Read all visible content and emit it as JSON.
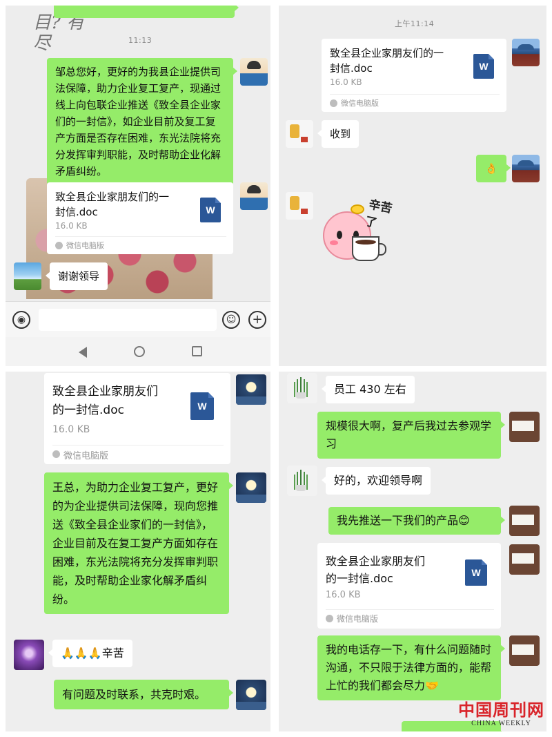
{
  "file_card": {
    "name_full": "致全县企业家朋友们的一封信.doc",
    "name_line1": "致全县企业家朋友们的一",
    "name_line1_p3": "致全县企业家朋友们",
    "name_line2": "封信.doc",
    "name_line2_p3": "的一封信.doc",
    "size": "16.0 KB",
    "source": "微信电脑版",
    "icon_letter": "W"
  },
  "panel1": {
    "time": "11:13",
    "calligraphy": "目? 有尽",
    "messages": [
      {
        "type": "text",
        "side": "right",
        "text": "邹总您好，更好的为我县企业提供司法保障，助力企业复工复产，现通过线上向包联企业推送《致全县企业家们的一封信》，如企业目前及复工复产方面是否存在困难，东光法院将充分发挥审判职能，及时帮助企业化解矛盾纠纷。"
      },
      {
        "type": "file",
        "side": "right"
      },
      {
        "type": "text",
        "side": "left",
        "text": "谢谢领导"
      }
    ],
    "input_bar": {
      "voice_icon": "voice-icon",
      "emoji_icon": "emoji-icon",
      "plus_icon": "plus-icon"
    },
    "nav": {
      "back": "back-icon",
      "home": "home-icon",
      "recent": "recent-apps-icon"
    }
  },
  "panel2": {
    "time": "上午11:14",
    "messages": [
      {
        "type": "file",
        "side": "right"
      },
      {
        "type": "text",
        "side": "left",
        "text": "收到"
      },
      {
        "type": "emoji",
        "side": "right",
        "text": "👌"
      },
      {
        "type": "sticker",
        "side": "left",
        "text": "辛苦了"
      }
    ]
  },
  "panel3": {
    "messages": [
      {
        "type": "file",
        "side": "right"
      },
      {
        "type": "text",
        "side": "right",
        "text": "王总，为助力企业复工复产，更好的为企业提供司法保障，现向您推送《致全县企业家们的一封信》，企业目前及在复工复产方面如存在困难，东光法院将充分发挥审判职能，及时帮助企业家化解矛盾纠纷。"
      },
      {
        "type": "text",
        "side": "left",
        "text": "🙏🙏🙏辛苦"
      },
      {
        "type": "text",
        "side": "right",
        "text": "有问题及时联系，共克时艰。"
      }
    ]
  },
  "panel4": {
    "messages": [
      {
        "type": "text",
        "side": "left",
        "text": "员工 430 左右"
      },
      {
        "type": "text",
        "side": "right",
        "text": "规模很大啊，复产后我过去参观学习"
      },
      {
        "type": "text",
        "side": "left",
        "text": "好的，欢迎领导啊"
      },
      {
        "type": "text",
        "side": "right",
        "text": "我先推送一下我们的产品😊"
      },
      {
        "type": "file",
        "side": "right"
      },
      {
        "type": "text",
        "side": "right",
        "text": "我的电话存一下，有什么问题随时沟通，不只限于法律方面的，能帮上忙的我们都会尽力🤝"
      }
    ]
  },
  "watermark": {
    "cn": "中国周刊网",
    "en": "CHINA WEEKLY"
  }
}
